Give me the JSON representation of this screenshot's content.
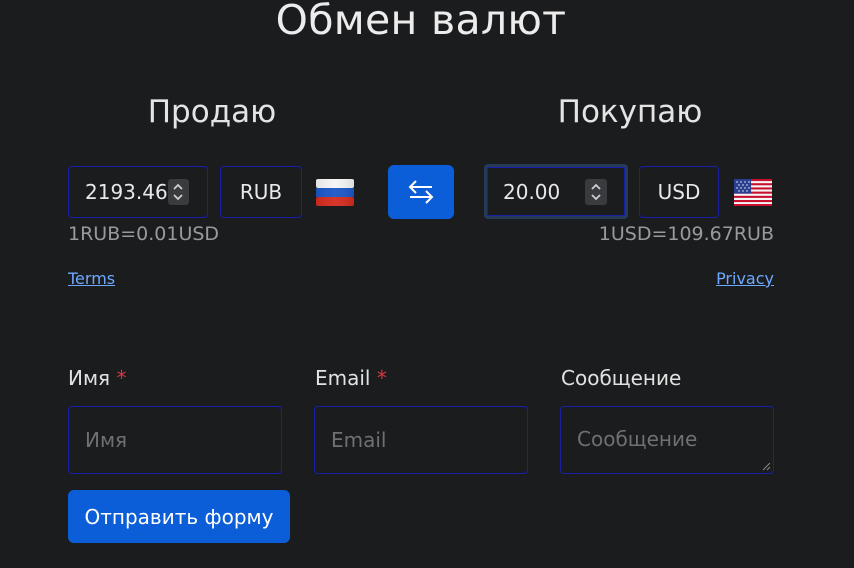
{
  "title": "Обмен валют",
  "sell": {
    "heading": "Продаю",
    "amount": "2193.46",
    "currency": "RUB",
    "flag_icon": "russia-flag-icon",
    "rate": "1RUB=0.01USD"
  },
  "buy": {
    "heading": "Покупаю",
    "amount": "20.00",
    "currency": "USD",
    "flag_icon": "usa-flag-icon",
    "rate": "1USD=109.67RUB"
  },
  "swap_icon": "swap-arrows-icon",
  "links": {
    "terms": "Terms",
    "privacy": "Privacy"
  },
  "form": {
    "name_label": "Имя",
    "name_placeholder": "Имя",
    "email_label": "Email",
    "email_placeholder": "Email",
    "message_label": "Сообщение",
    "message_placeholder": "Сообщение",
    "required_mark": "*",
    "submit_label": "Отправить форму"
  },
  "colors": {
    "background": "#1b1c1e",
    "accent": "#0b5ed7",
    "field_border": "#1a1fa8",
    "link": "#6ea8fe",
    "required": "#dc3545"
  }
}
